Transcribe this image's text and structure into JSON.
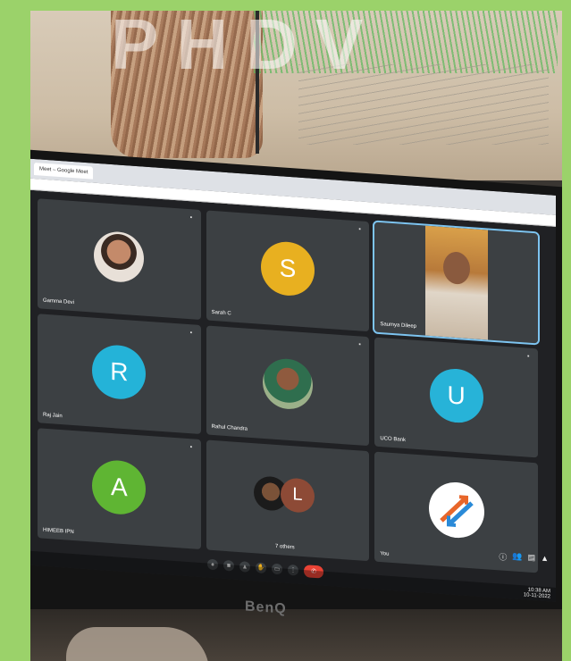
{
  "watermark": "PHDV",
  "browser": {
    "tab_label": "Meet – Google Meet",
    "url": "meet.google.com"
  },
  "meeting": {
    "tiles": [
      {
        "name": "Gamma Devi",
        "kind": "photo"
      },
      {
        "name": "Sarah C",
        "initial": "S",
        "color": "#e8b020"
      },
      {
        "name": "Saumya Dileep",
        "kind": "video"
      },
      {
        "name": "Raj Jain",
        "initial": "R",
        "color": "#24b3d8"
      },
      {
        "name": "Rahul Chandra",
        "kind": "photo"
      },
      {
        "name": "UCO Bank",
        "initial": "U",
        "color": "#27b3d8"
      },
      {
        "name": "HIMEEB IPN",
        "initial": "A",
        "color": "#5fb533"
      },
      {
        "name": "7 others",
        "kind": "others",
        "initial": "L"
      },
      {
        "name": "You",
        "kind": "logo"
      }
    ]
  },
  "controls": [
    "mic",
    "camera",
    "present",
    "hand",
    "captions",
    "more",
    "end-call"
  ],
  "clock": {
    "time": "10:38 AM",
    "date": "10-11-2022"
  },
  "monitor_brand": "BenQ"
}
